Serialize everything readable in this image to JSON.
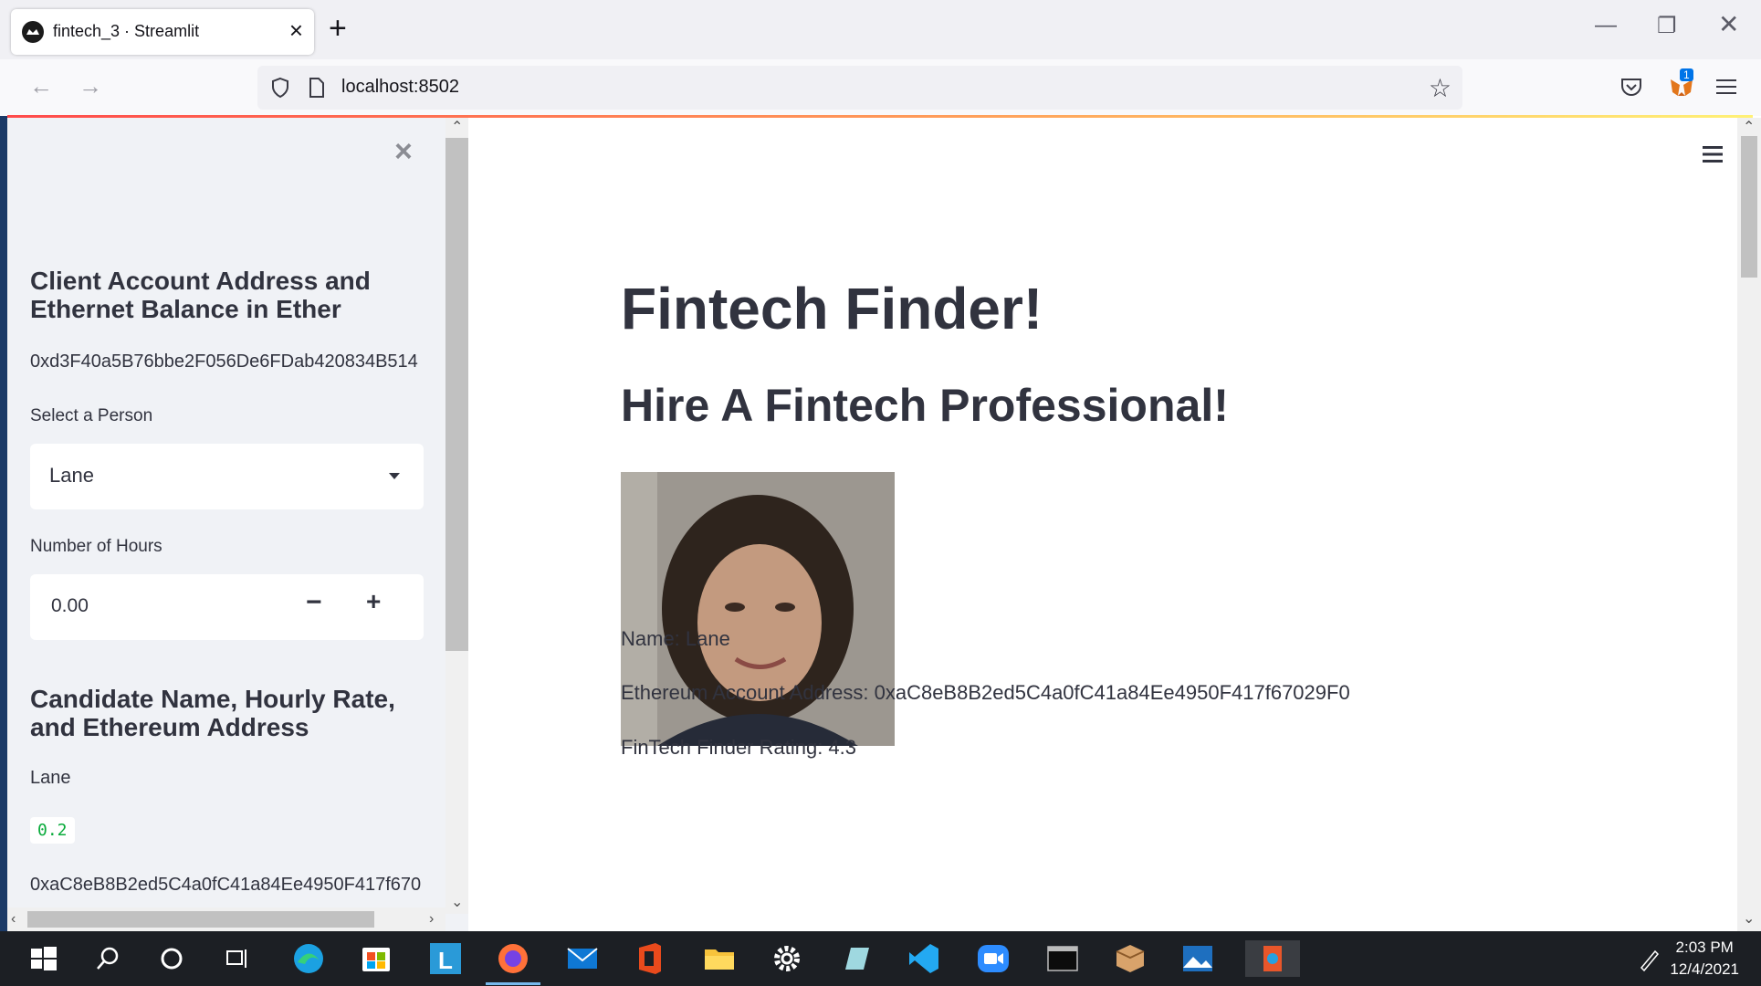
{
  "browser": {
    "tab_title": "fintech_3 · Streamlit",
    "url": "localhost:8502",
    "extension_badge": "1"
  },
  "sidebar": {
    "heading_1": "Client Account Address and Ethernet Balance in Ether",
    "client_address": "0xd3F40a5B76bbe2F056De6FDab420834B514",
    "select_label": "Select a Person",
    "selected_person": "Lane",
    "hours_label": "Number of Hours",
    "hours_value": "0.00",
    "stepper_minus": "−",
    "stepper_plus": "+",
    "heading_2": "Candidate Name, Hourly Rate, and Ethereum Address",
    "candidate_name": "Lane",
    "hourly_rate": "0.2",
    "candidate_eth": "0xaC8eB8B2ed5C4a0fC41a84Ee4950F417f670"
  },
  "main": {
    "title": "Fintech Finder!",
    "subtitle": "Hire A Fintech Professional!",
    "name_line": "Name: Lane",
    "eth_line": "Ethereum Account Address: 0xaC8eB8B2ed5C4a0fC41a84Ee4950F417f67029F0",
    "rating_line": "FinTech Finder Rating: 4.3"
  },
  "taskbar": {
    "time": "2:03 PM",
    "date": "12/4/2021"
  },
  "colors": {
    "accent": "#ff4b4b",
    "sidebar_bg": "#f0f2f6",
    "code_green": "#09ab3b",
    "taskbar_bg": "#1c1f24"
  }
}
